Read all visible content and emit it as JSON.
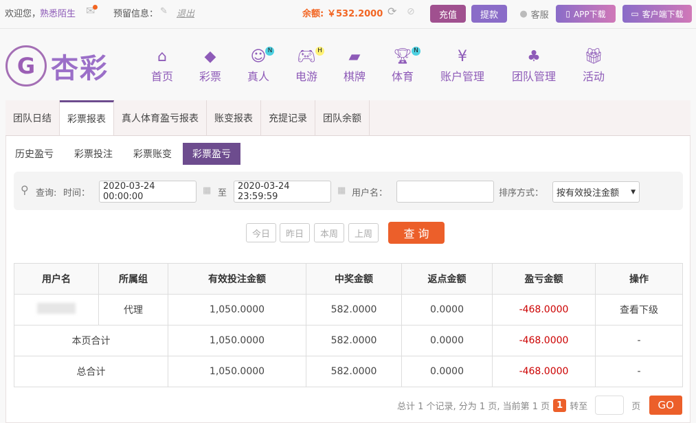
{
  "topbar": {
    "welcome": "欢迎您，",
    "username": "熟悉陌生",
    "reserved_label": "预留信息：",
    "logout": "退出",
    "balance_label": "余额:",
    "balance": "￥532.2000",
    "recharge": "充值",
    "withdraw": "提款",
    "service": "客服",
    "app_download": "APP下载",
    "client_download": "客户端下载"
  },
  "logo": {
    "text": "杏彩"
  },
  "nav": [
    {
      "label": "首页",
      "icon": "home-icon"
    },
    {
      "label": "彩票",
      "icon": "ticket-icon"
    },
    {
      "label": "真人",
      "icon": "dealer-icon",
      "badge": "N"
    },
    {
      "label": "电游",
      "icon": "gamepad-icon",
      "badge": "H"
    },
    {
      "label": "棋牌",
      "icon": "cards-icon"
    },
    {
      "label": "体育",
      "icon": "trophy-icon",
      "badge": "N"
    },
    {
      "label": "账户管理",
      "icon": "yen-icon"
    },
    {
      "label": "团队管理",
      "icon": "team-icon"
    },
    {
      "label": "活动",
      "icon": "gift-icon"
    }
  ],
  "tabs": [
    "团队日结",
    "彩票报表",
    "真人体育盈亏报表",
    "账变报表",
    "充提记录",
    "团队余额"
  ],
  "subtabs": [
    "历史盈亏",
    "彩票投注",
    "彩票账变",
    "彩票盈亏"
  ],
  "filter": {
    "query_label": "查询:",
    "time_label": "时间：",
    "start": "2020-03-24 00:00:00",
    "to": "至",
    "end": "2020-03-24 23:59:59",
    "user_label": "用户名：",
    "user_value": "",
    "sort_label": "排序方式：",
    "sort_value": "按有效投注金额"
  },
  "quick": [
    "今日",
    "昨日",
    "本周",
    "上周"
  ],
  "search_button": "查 询",
  "table": {
    "headers": [
      "用户名",
      "所属组",
      "有效投注金额",
      "中奖金额",
      "返点金额",
      "盈亏金额",
      "操作"
    ],
    "row": {
      "group": "代理",
      "bet": "1,050.0000",
      "win": "582.0000",
      "rebate": "0.0000",
      "pl": "-468.0000",
      "action": "查看下级"
    },
    "page_total": {
      "label": "本页合计",
      "bet": "1,050.0000",
      "win": "582.0000",
      "rebate": "0.0000",
      "pl": "-468.0000",
      "action": "-"
    },
    "grand_total": {
      "label": "总合计",
      "bet": "1,050.0000",
      "win": "582.0000",
      "rebate": "0.0000",
      "pl": "-468.0000",
      "action": "-"
    }
  },
  "pager": {
    "summary": "总计 1 个记录, 分为 1 页, 当前第 1 页",
    "current": "1",
    "goto": "转至",
    "page": "页",
    "go": "GO"
  }
}
